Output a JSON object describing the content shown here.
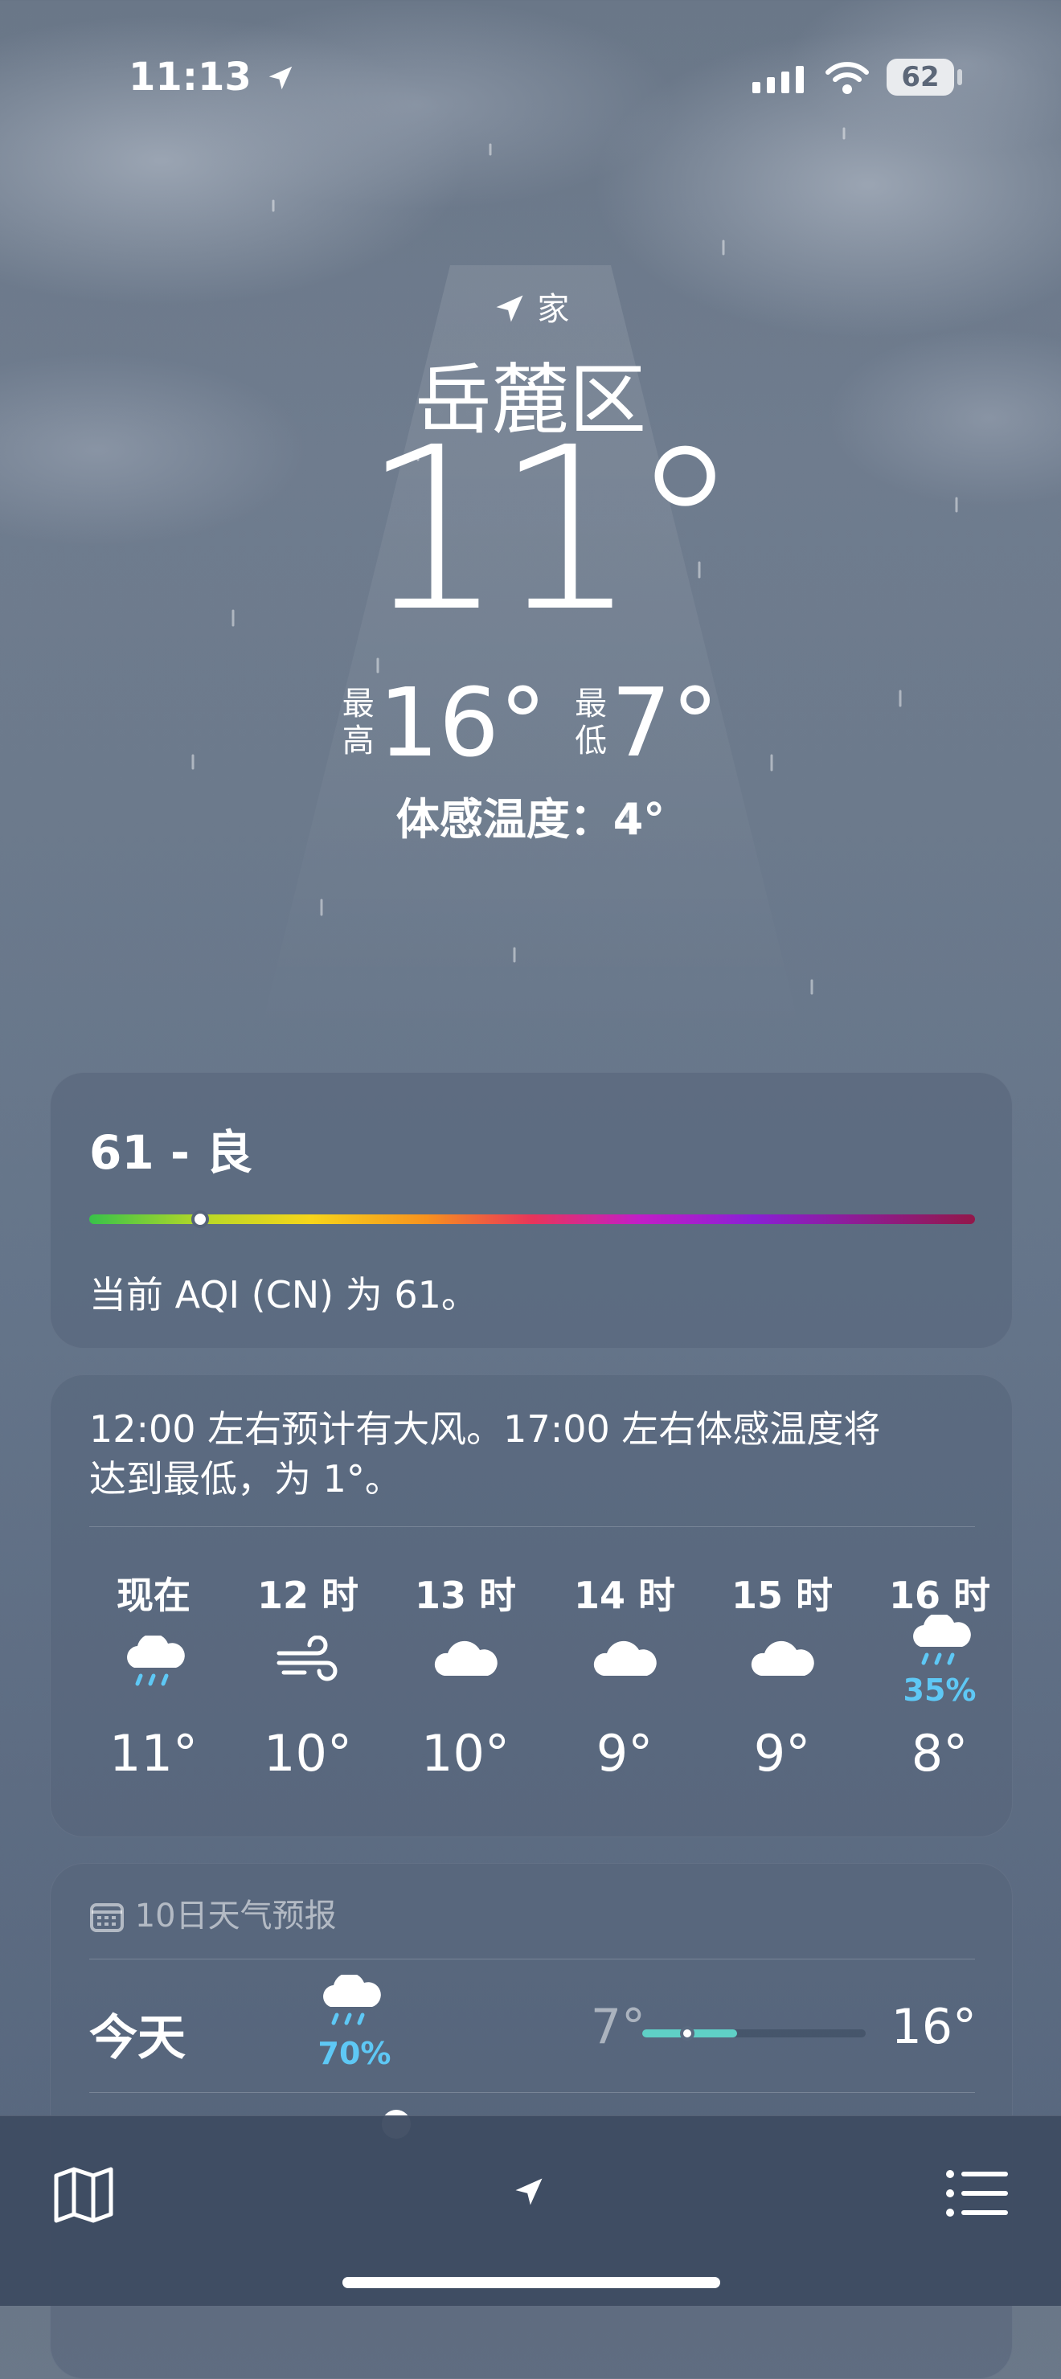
{
  "status_bar": {
    "time": "11:13",
    "battery": "62"
  },
  "header": {
    "location_tag": "家",
    "city": "岳麓区",
    "temperature": "11°",
    "high_label_1": "最",
    "high_label_2": "高",
    "high_value": "16°",
    "low_label_1": "最",
    "low_label_2": "低",
    "low_value": "7°",
    "feels_like": "体感温度：4°"
  },
  "aqi": {
    "title": "61 - 良",
    "description": "当前 AQI (CN) 为 61。",
    "value": 61,
    "indicator_fraction": 0.125,
    "colors": [
      "#38c24a",
      "#b9d826",
      "#f6d51a",
      "#f7921e",
      "#e8355a",
      "#c21ec6",
      "#8a20d4",
      "#92184a"
    ]
  },
  "hourly": {
    "summary_line1": "12:00 左右预计有大风。17:00 左右体感温度将",
    "summary_line2": "达到最低，为 1°。",
    "hours": [
      {
        "label": "现在",
        "icon": "rain-cloud-icon",
        "temp": "11°",
        "precip": ""
      },
      {
        "label": "12 时",
        "icon": "wind-icon",
        "temp": "10°",
        "precip": ""
      },
      {
        "label": "13 时",
        "icon": "cloud-icon",
        "temp": "10°",
        "precip": ""
      },
      {
        "label": "14 时",
        "icon": "cloud-icon",
        "temp": "9°",
        "precip": ""
      },
      {
        "label": "15 时",
        "icon": "cloud-icon",
        "temp": "9°",
        "precip": ""
      },
      {
        "label": "16 时",
        "icon": "rain-cloud-icon",
        "temp": "8°",
        "precip": "35%"
      }
    ],
    "precip_color": "#5ec8f5"
  },
  "forecast": {
    "title": "10日天气预报",
    "days": [
      {
        "day": "今天",
        "icon": "rain-cloud-icon",
        "precip": "70%",
        "low": "7°",
        "high": "16°",
        "current_fraction": 0.2
      }
    ],
    "bar_color": "#5fd0c6"
  },
  "tab_bar": {
    "map": "map-icon",
    "location": "location-arrow-icon",
    "list": "list-icon"
  }
}
